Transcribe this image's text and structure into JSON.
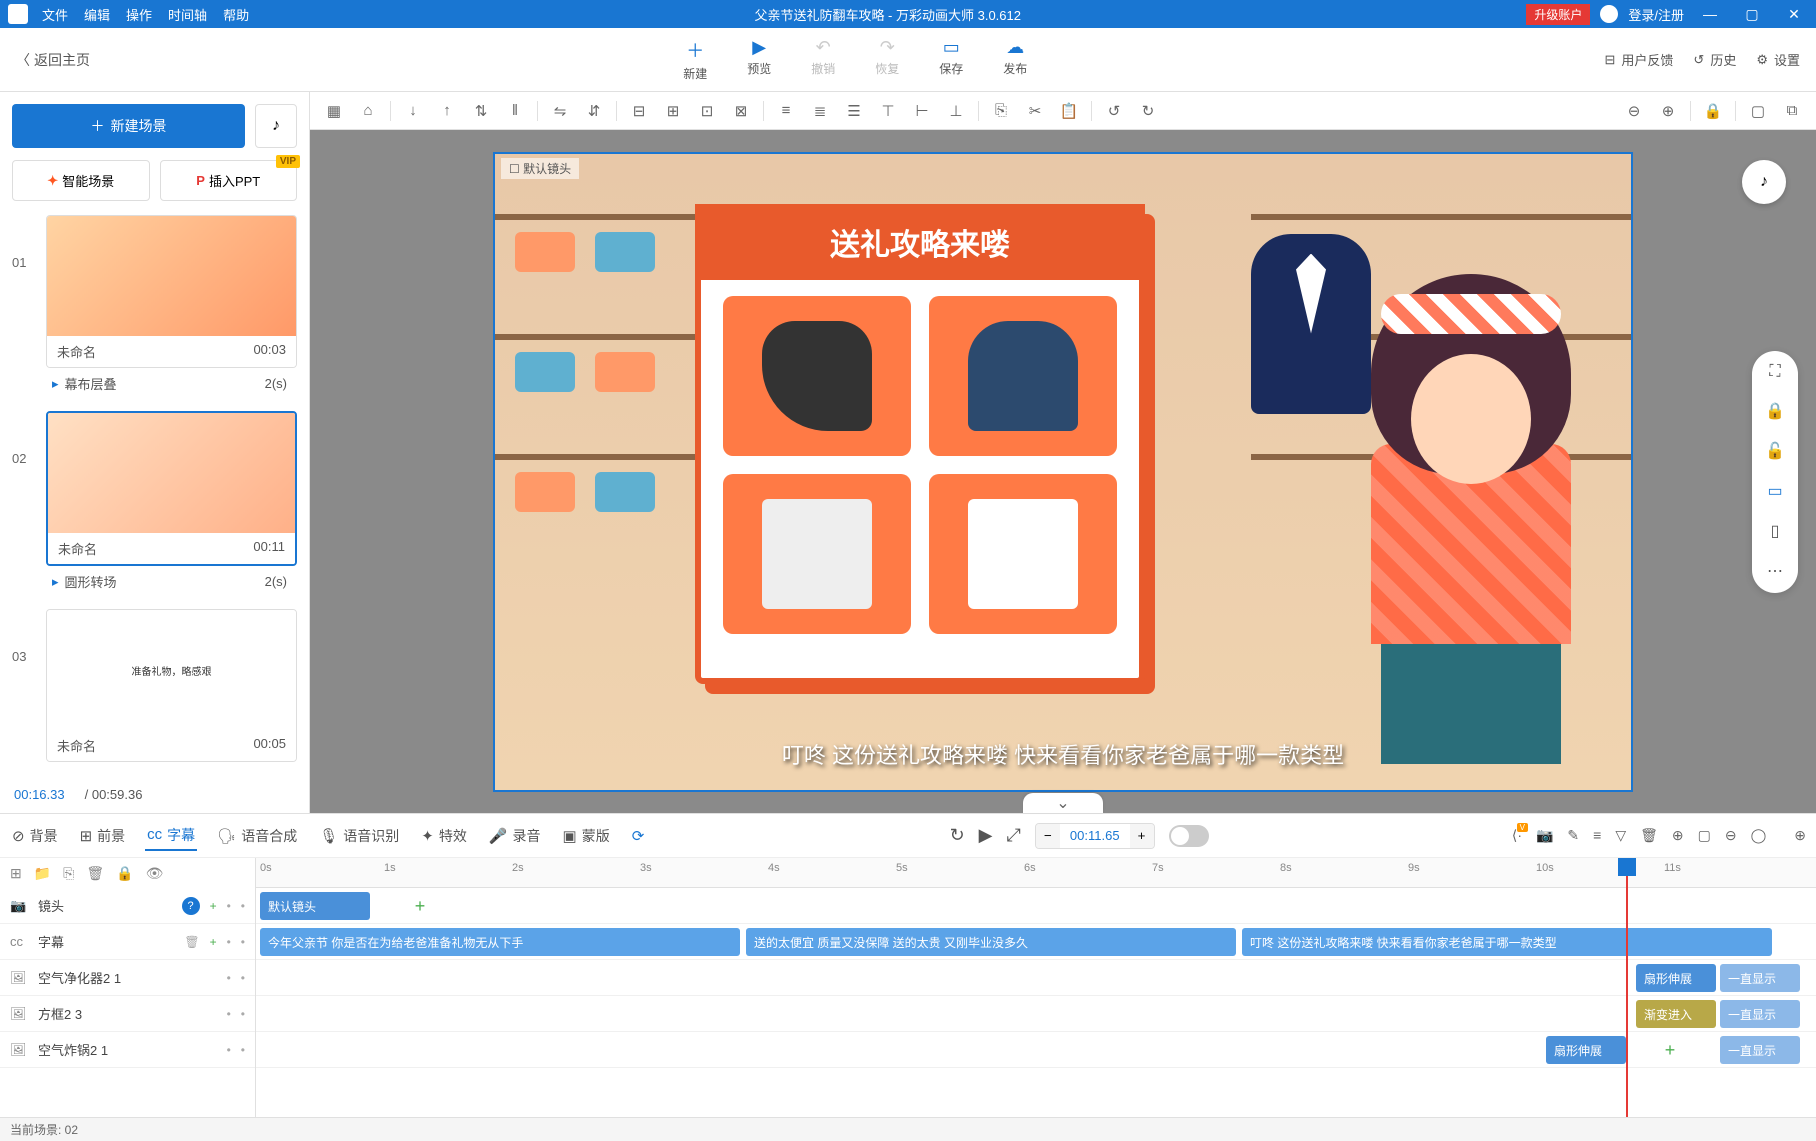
{
  "titlebar": {
    "menus": [
      "文件",
      "编辑",
      "操作",
      "时间轴",
      "帮助"
    ],
    "center": "父亲节送礼防翻车攻略 - 万彩动画大师 3.0.612",
    "upgrade": "升级账户",
    "login": "登录/注册"
  },
  "ribbon": {
    "back": "返回主页",
    "buttons": [
      {
        "icon": "＋",
        "label": "新建"
      },
      {
        "icon": "▶",
        "label": "预览"
      },
      {
        "icon": "↶",
        "label": "撤销"
      },
      {
        "icon": "↷",
        "label": "恢复"
      },
      {
        "icon": "▭",
        "label": "保存"
      },
      {
        "icon": "☁",
        "label": "发布"
      }
    ],
    "right": [
      {
        "icon": "⊟",
        "label": "用户反馈"
      },
      {
        "icon": "↺",
        "label": "历史"
      },
      {
        "icon": "⚙",
        "label": "设置"
      }
    ]
  },
  "scenePanel": {
    "newScene": "新建场景",
    "aiScene": "智能场景",
    "insertPPT": "插入PPT",
    "vip": "VIP",
    "scenes": [
      {
        "num": "01",
        "name": "未命名",
        "time": "00:03",
        "trans": "幕布层叠",
        "transDur": "2(s)"
      },
      {
        "num": "02",
        "name": "未命名",
        "time": "00:11",
        "trans": "圆形转场",
        "transDur": "2(s)"
      },
      {
        "num": "03",
        "name": "未命名",
        "time": "00:05"
      }
    ],
    "thumb3_title": "准备礼物，略感艰",
    "timeCurrent": "00:16.33",
    "timeTotal": "/ 00:59.36"
  },
  "canvas": {
    "cameraLabel": "默认镜头",
    "giftTitle": "送礼攻略来喽",
    "subtitle": "叮咚 这份送礼攻略来喽  快来看看你家老爸属于哪一款类型"
  },
  "bottomTabs": {
    "tabs": [
      {
        "icon": "⊘",
        "label": "背景"
      },
      {
        "icon": "⊞",
        "label": "前景"
      },
      {
        "icon": "cc",
        "label": "字幕"
      },
      {
        "icon": "🗣",
        "label": "语音合成"
      },
      {
        "icon": "🎙",
        "label": "语音识别"
      },
      {
        "icon": "✦",
        "label": "特效"
      },
      {
        "icon": "🎤",
        "label": "录音"
      },
      {
        "icon": "▣",
        "label": "蒙版"
      }
    ],
    "playTime": "00:11.65"
  },
  "timeline": {
    "ticks": [
      "0s",
      "1s",
      "2s",
      "3s",
      "4s",
      "5s",
      "6s",
      "7s",
      "8s",
      "9s",
      "10s",
      "11s"
    ],
    "leftRows": [
      {
        "icon": "📷",
        "label": "镜头",
        "help": true
      },
      {
        "icon": "cc",
        "label": "字幕"
      },
      {
        "icon": "🖼",
        "label": "空气净化器2 1"
      },
      {
        "icon": "🖼",
        "label": "方框2 3"
      },
      {
        "icon": "🖼",
        "label": "空气炸锅2 1"
      }
    ],
    "cameraClip": "默认镜头",
    "subtitleClips": [
      "今年父亲节 你是否在为给老爸准备礼物无从下手",
      "送的太便宜 质量又没保障 送的太贵 又刚毕业没多久",
      "叮咚 这份送礼攻略来喽  快来看看你家老爸属于哪一款类型"
    ],
    "effectLabels": {
      "shapeExtend": "扇形伸展",
      "alwaysShow": "一直显示",
      "fadeIn": "渐变进入"
    }
  },
  "footer": {
    "currentScene": "当前场景: 02"
  }
}
